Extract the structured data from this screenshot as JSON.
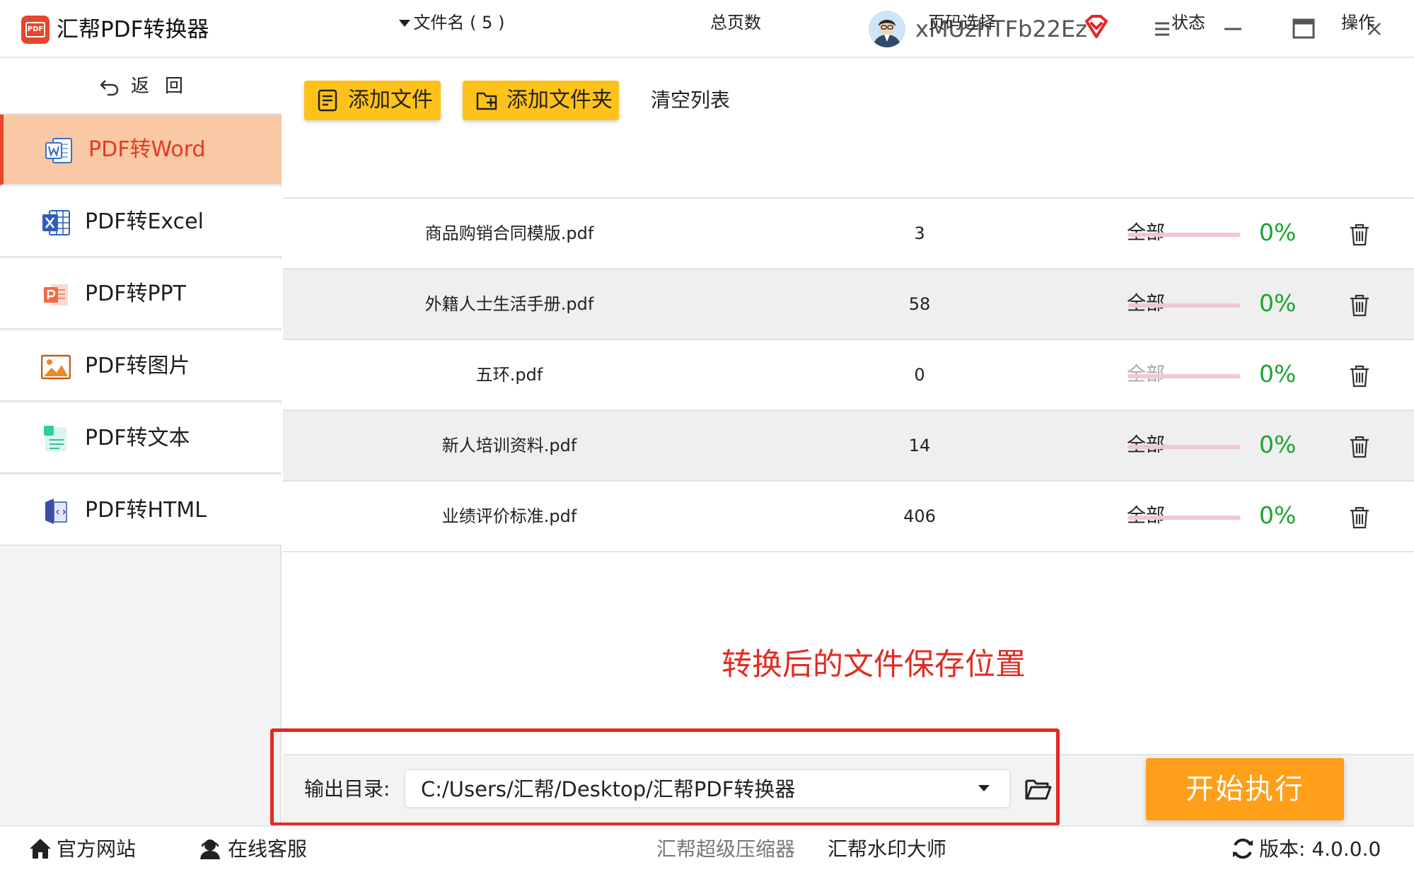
{
  "titlebar": {
    "app_title": "汇帮PDF转换器",
    "logo_text": "PDF",
    "username": "xMUzhTFb22Ez"
  },
  "sidebar": {
    "back_label": "返回",
    "items": [
      {
        "label": "PDF转Word",
        "icon": "word-icon",
        "active": true
      },
      {
        "label": "PDF转Excel",
        "icon": "excel-icon",
        "active": false
      },
      {
        "label": "PDF转PPT",
        "icon": "ppt-icon",
        "active": false
      },
      {
        "label": "PDF转图片",
        "icon": "image-icon",
        "active": false
      },
      {
        "label": "PDF转文本",
        "icon": "text-icon",
        "active": false
      },
      {
        "label": "PDF转HTML",
        "icon": "html-icon",
        "active": false
      }
    ]
  },
  "toolbar": {
    "add_file_label": "添加文件",
    "add_folder_label": "添加文件夹",
    "clear_label": "清空列表"
  },
  "table": {
    "headers": {
      "name": "文件名 ( 5 )",
      "pages": "总页数",
      "range": "页码选择",
      "status": "状态",
      "actions": "操作"
    },
    "rows": [
      {
        "name": "商品购销合同模版.pdf",
        "pages": "3",
        "range": "全部",
        "progress": 0,
        "percent": "0%",
        "range_disabled": false
      },
      {
        "name": "外籍人士生活手册.pdf",
        "pages": "58",
        "range": "全部",
        "progress": 0,
        "percent": "0%",
        "range_disabled": false
      },
      {
        "name": "五环.pdf",
        "pages": "0",
        "range": "全部",
        "progress": 0,
        "percent": "0%",
        "range_disabled": true
      },
      {
        "name": "新人培训资料.pdf",
        "pages": "14",
        "range": "全部",
        "progress": 0,
        "percent": "0%",
        "range_disabled": false
      },
      {
        "name": "业绩评价标准.pdf",
        "pages": "406",
        "range": "全部",
        "progress": 0,
        "percent": "0%",
        "range_disabled": false
      }
    ]
  },
  "annotation": {
    "text": "转换后的文件保存位置"
  },
  "output": {
    "label": "输出目录:",
    "path": "C:/Users/汇帮/Desktop/汇帮PDF转换器"
  },
  "start_label": "开始执行",
  "statusbar": {
    "website": "官方网站",
    "support": "在线客服",
    "compressor": "汇帮超级压缩器",
    "watermark": "汇帮水印大师",
    "version": "版本: 4.0.0.0"
  },
  "colors": {
    "accent": "#ffc21a",
    "start": "#ff9f1a",
    "active_nav_bg": "#f9c8a4",
    "active_nav_text": "#e23b25",
    "percent": "#1aa52d",
    "annotation": "#e12b22"
  }
}
